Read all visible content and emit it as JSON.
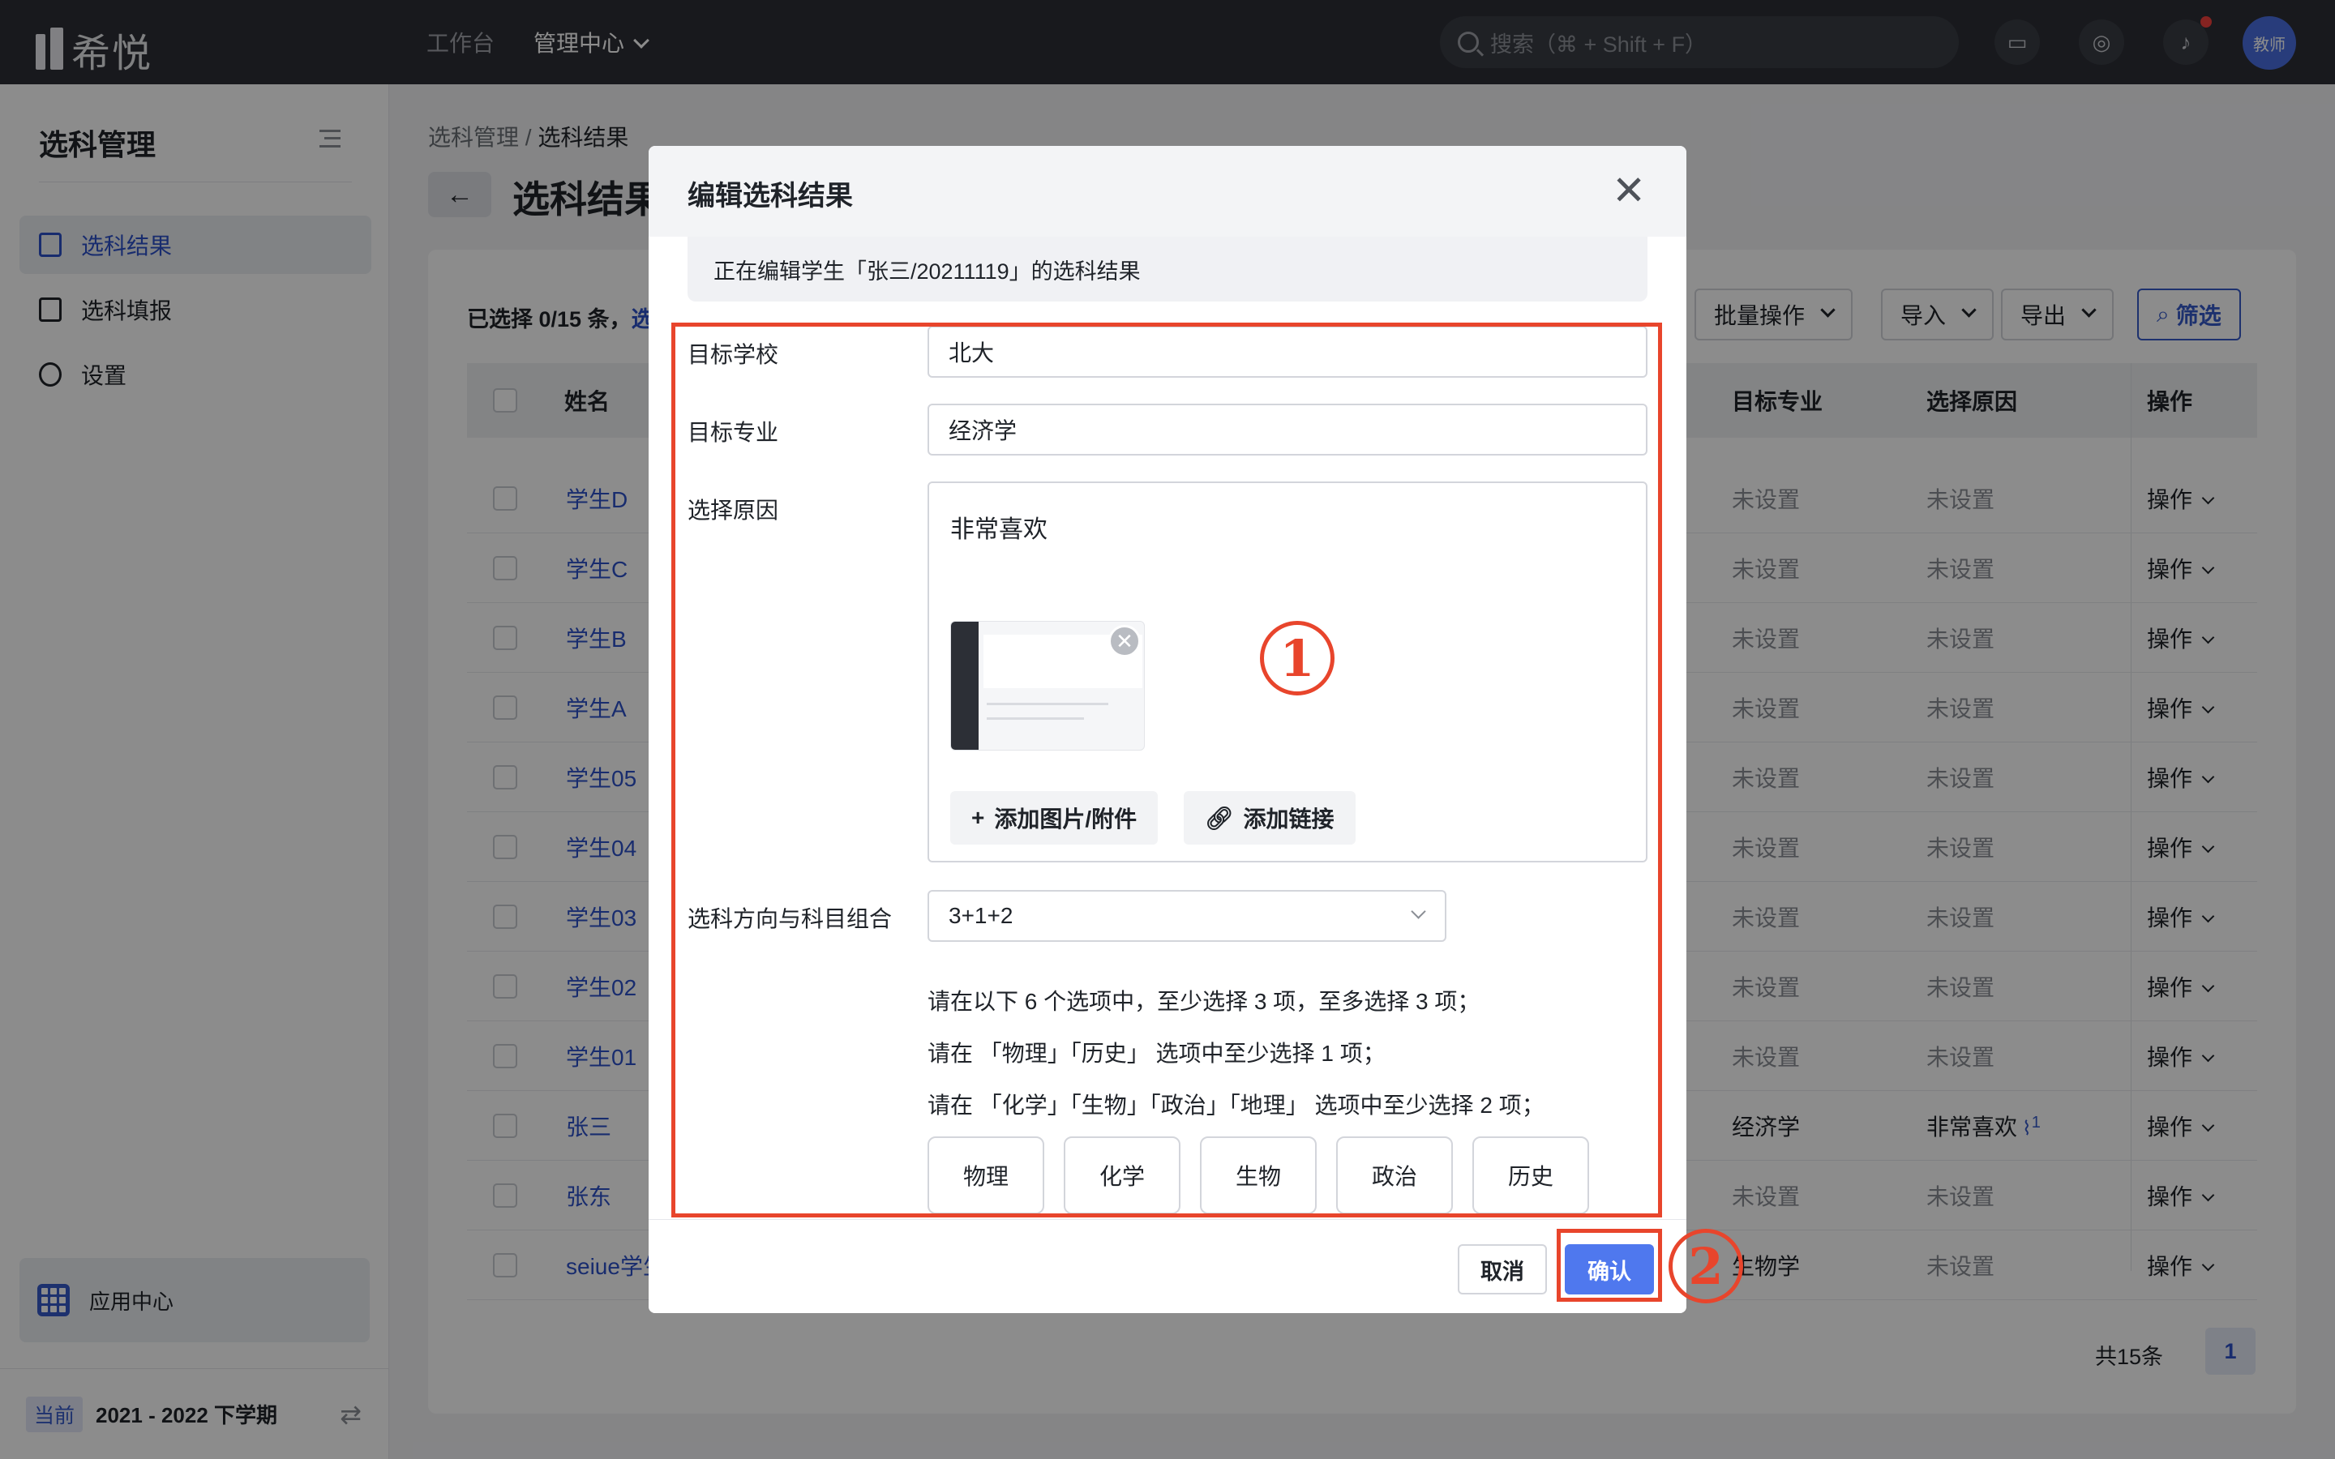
{
  "topbar": {
    "logo_text": "希悦",
    "nav": [
      "工作台",
      "管理中心"
    ],
    "search_placeholder": "搜索（⌘ + Shift + F）",
    "avatar_text": "教师"
  },
  "sidebar": {
    "title": "选科管理",
    "items": [
      {
        "label": "选科结果",
        "icon": "document-icon",
        "active": true
      },
      {
        "label": "选科填报",
        "icon": "edit-document-icon",
        "active": false
      },
      {
        "label": "设置",
        "icon": "gear-icon",
        "active": false
      }
    ],
    "app_center": "应用中心",
    "semester_badge": "当前",
    "semester": "2021 - 2022 下学期"
  },
  "main": {
    "breadcrumb": [
      "选科管理",
      "选科结果"
    ],
    "title": "选科结果",
    "selected": "已选择 0/15 条，",
    "selected_link": "选",
    "toolbar": {
      "batch": "批量操作",
      "import": "导入",
      "export": "导出",
      "filter": "筛选"
    },
    "columns": {
      "name": "姓名",
      "major": "目标专业",
      "reason": "选择原因",
      "ops": "操作"
    },
    "rows": [
      {
        "name": "学生D",
        "major": "未设置",
        "reason": "未设置",
        "op": "操作"
      },
      {
        "name": "学生C",
        "major": "未设置",
        "reason": "未设置",
        "op": "操作"
      },
      {
        "name": "学生B",
        "major": "未设置",
        "reason": "未设置",
        "op": "操作"
      },
      {
        "name": "学生A",
        "major": "未设置",
        "reason": "未设置",
        "op": "操作"
      },
      {
        "name": "学生05",
        "major": "未设置",
        "reason": "未设置",
        "op": "操作"
      },
      {
        "name": "学生04",
        "major": "未设置",
        "reason": "未设置",
        "op": "操作"
      },
      {
        "name": "学生03",
        "major": "未设置",
        "reason": "未设置",
        "op": "操作"
      },
      {
        "name": "学生02",
        "major": "未设置",
        "reason": "未设置",
        "op": "操作"
      },
      {
        "name": "学生01",
        "major": "未设置",
        "reason": "未设置",
        "op": "操作"
      },
      {
        "name": "张三",
        "major": "经济学",
        "reason": "非常喜欢",
        "attach": "1",
        "op": "操作"
      },
      {
        "name": "张东",
        "major": "未设置",
        "reason": "未设置",
        "op": "操作"
      },
      {
        "name": "seiue学生",
        "major": "生物学",
        "reason": "未设置",
        "op": "操作"
      }
    ],
    "total": "共15条",
    "page": "1"
  },
  "modal": {
    "title": "编辑选科结果",
    "notice": "正在编辑学生「张三/20211119」的选科结果",
    "fields": {
      "school_label": "目标学校",
      "school_value": "北大",
      "major_label": "目标专业",
      "major_value": "经济学",
      "reason_label": "选择原因",
      "reason_value": "非常喜欢",
      "add_attachment": "添加图片/附件",
      "add_link": "添加链接",
      "combo_label": "选科方向与科目组合",
      "combo_value": "3+1+2"
    },
    "rules": [
      "请在以下 6 个选项中，至少选择 3 项，至多选择 3 项；",
      "请在 「物理」「历史」 选项中至少选择 1 项；",
      "请在 「化学」「生物」「政治」「地理」 选项中至少选择 2 项；"
    ],
    "subjects": [
      "物理",
      "化学",
      "生物",
      "政治",
      "历史"
    ],
    "cancel": "取消",
    "confirm": "确认"
  },
  "annotations": {
    "one": "1",
    "two": "2"
  },
  "colors": {
    "accent": "#4f78ee",
    "link": "#2d50c8",
    "annotation": "#e8452c",
    "topbar": "#2c2f36"
  }
}
